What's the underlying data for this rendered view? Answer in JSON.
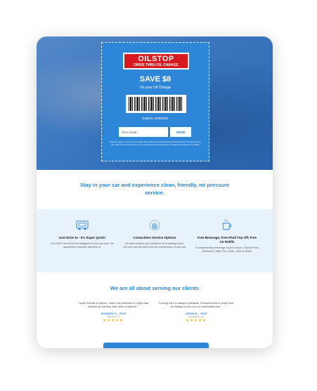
{
  "coupon": {
    "logo_main": "OILSTOP",
    "logo_sub": "DRIVE THRU OIL CHANGE",
    "headline": "SAVE $8",
    "subline": "On your Oil Change",
    "expires": "Expires: 6/18/2021",
    "email_placeholder": "Your email...",
    "send_label": "SEND",
    "fineprint": "Bring this coupon or show on your mobile device. Offer good at participating Oil Stop locations. Not valid with any other offer. Limit one per customer per visit. Expires on date shown above. Please visit oilstop.com for details."
  },
  "headline": "Stay in your car and experience clean, friendly, no pressure service.",
  "features": [
    {
      "icon": "car-service-icon",
      "title": "Just Drive In - It's Super Quick!",
      "desc": "Our Drive Thru Service is designed to save you time. No appointment needed, just drive in."
    },
    {
      "icon": "contactless-hand-icon",
      "title": "Contactless Service Options",
      "desc": "No need to leave your vehicle to sit in waiting rooms. Get your service done from the convenience of your car."
    },
    {
      "icon": "coffee-cup-icon",
      "title": "Free Beverage, Free Fluid Top Off, Free Air Refills",
      "desc": "A complimentary beverage of your choice. Choose From Starbucks Coffee, Tea, Soda, Juice or Water."
    }
  ],
  "reviews_title": "We are all about serving our clients",
  "reviews": [
    {
      "quote": "\"Super friendly & helpful. I saw a lot confused on a light that showed up but they were able to help me.\"",
      "author": "-XIOMARA S. - YELP",
      "location": "Alhambra, CA",
      "stars": "★★★★★"
    },
    {
      "quote": "\"Coming here is always a pleasure. Everyone here is super nice. I'm always in and out in a reasonable time.\"",
      "author": "-KEVIN M. - YELP",
      "location": "Santa Rosa, CA",
      "stars": "★★★★★"
    }
  ],
  "colors": {
    "brand_blue": "#2e86d8",
    "logo_red": "#d71920",
    "feature_bg": "#e8f2fb",
    "star": "#f4b400"
  }
}
